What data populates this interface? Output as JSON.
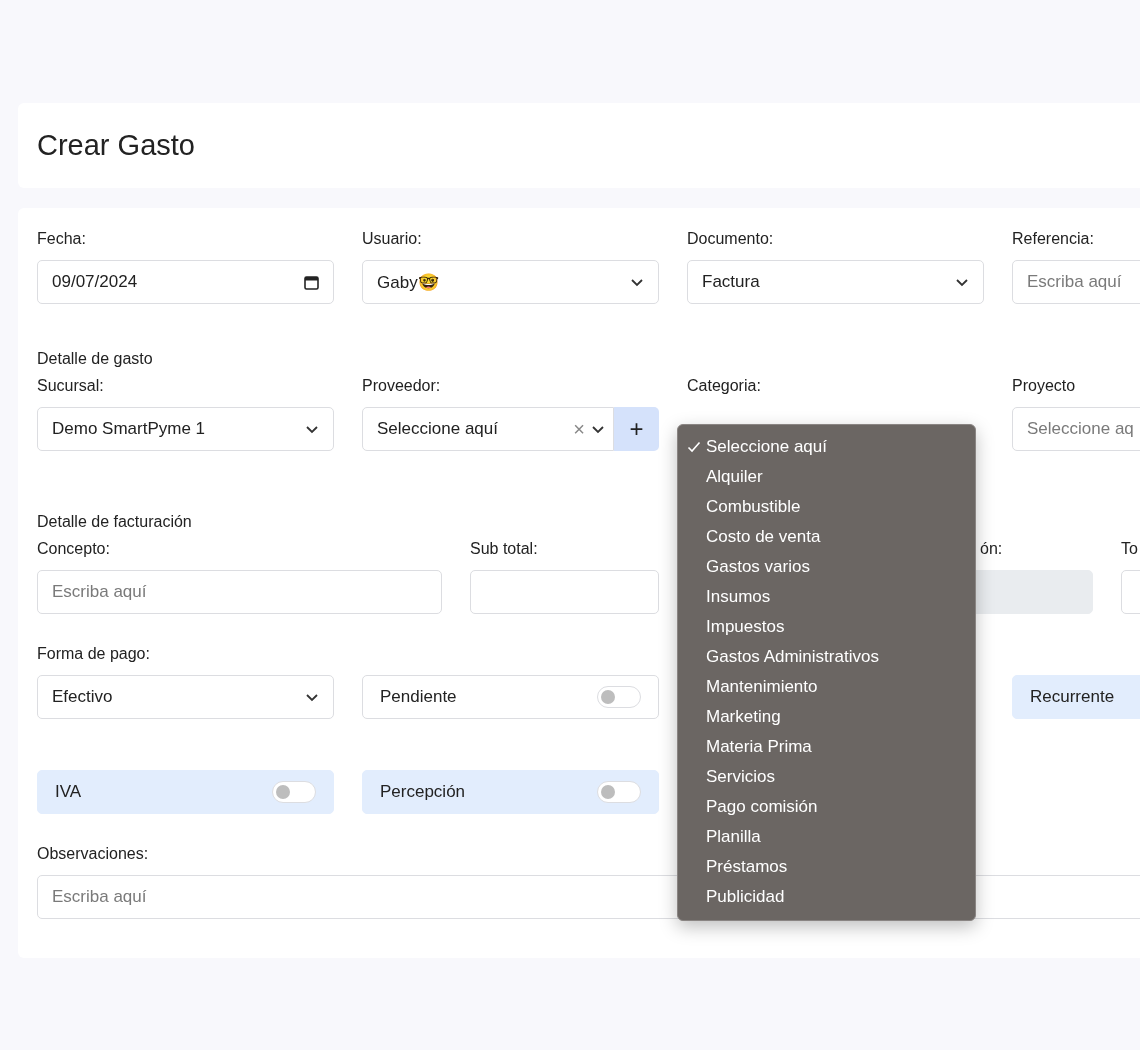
{
  "header": {
    "title": "Crear Gasto"
  },
  "general": [
    {
      "label": "Fecha:",
      "kind": "date",
      "value": "09/07/2024"
    },
    {
      "label": "Usuario:",
      "kind": "select",
      "value": "Gaby🤓"
    },
    {
      "label": "Documento:",
      "kind": "select",
      "value": "Factura"
    },
    {
      "label": "Referencia:",
      "kind": "text",
      "placeholder": "Escriba aquí"
    }
  ],
  "expense_detail": {
    "title": "Detalle de gasto",
    "fields": [
      {
        "label": "Sucursal:",
        "kind": "select",
        "value": "Demo SmartPyme 1"
      },
      {
        "label": "Proveedor:",
        "kind": "combo",
        "placeholder": "Seleccione aquí",
        "clear": "×",
        "add": "+"
      },
      {
        "label": "Categoria:",
        "kind": "covered"
      },
      {
        "label": "Proyecto",
        "kind": "text",
        "placeholder": "Seleccione aq"
      }
    ]
  },
  "billing": {
    "title": "Detalle de facturación",
    "fields": [
      {
        "label": "Concepto:",
        "kind": "text",
        "placeholder": "Escriba aquí"
      },
      {
        "label": "Sub total:",
        "kind": "text"
      },
      {
        "kind": "covered"
      },
      {
        "label": "ón:",
        "kind": "disabled_partial"
      },
      {
        "label": "To",
        "kind": "text"
      }
    ]
  },
  "payment": {
    "label": "Forma de pago:",
    "items": [
      {
        "kind": "select",
        "value": "Efectivo"
      },
      {
        "kind": "toggle",
        "label": "Pendiente",
        "highlighted": false,
        "on": false
      },
      {
        "kind": "covered"
      },
      {
        "kind": "toggle_cut",
        "label": "Recurrente",
        "highlighted": true
      }
    ]
  },
  "taxes": [
    {
      "label": "IVA",
      "highlighted": true,
      "on": false
    },
    {
      "label": "Percepción",
      "highlighted": true,
      "on": false
    }
  ],
  "observations": {
    "label": "Observaciones:",
    "placeholder": "Escriba aquí"
  },
  "category_menu": {
    "items": [
      {
        "label": "Seleccione aquí",
        "selected": true
      },
      {
        "label": "Alquiler",
        "selected": false
      },
      {
        "label": "Combustible",
        "selected": false
      },
      {
        "label": "Costo de venta",
        "selected": false
      },
      {
        "label": "Gastos varios",
        "selected": false
      },
      {
        "label": "Insumos",
        "selected": false
      },
      {
        "label": "Impuestos",
        "selected": false
      },
      {
        "label": "Gastos Administrativos",
        "selected": false
      },
      {
        "label": "Mantenimiento",
        "selected": false
      },
      {
        "label": "Marketing",
        "selected": false
      },
      {
        "label": "Materia Prima",
        "selected": false
      },
      {
        "label": "Servicios",
        "selected": false
      },
      {
        "label": "Pago comisión",
        "selected": false
      },
      {
        "label": "Planilla",
        "selected": false
      },
      {
        "label": "Préstamos",
        "selected": false
      },
      {
        "label": "Publicidad",
        "selected": false
      }
    ]
  }
}
